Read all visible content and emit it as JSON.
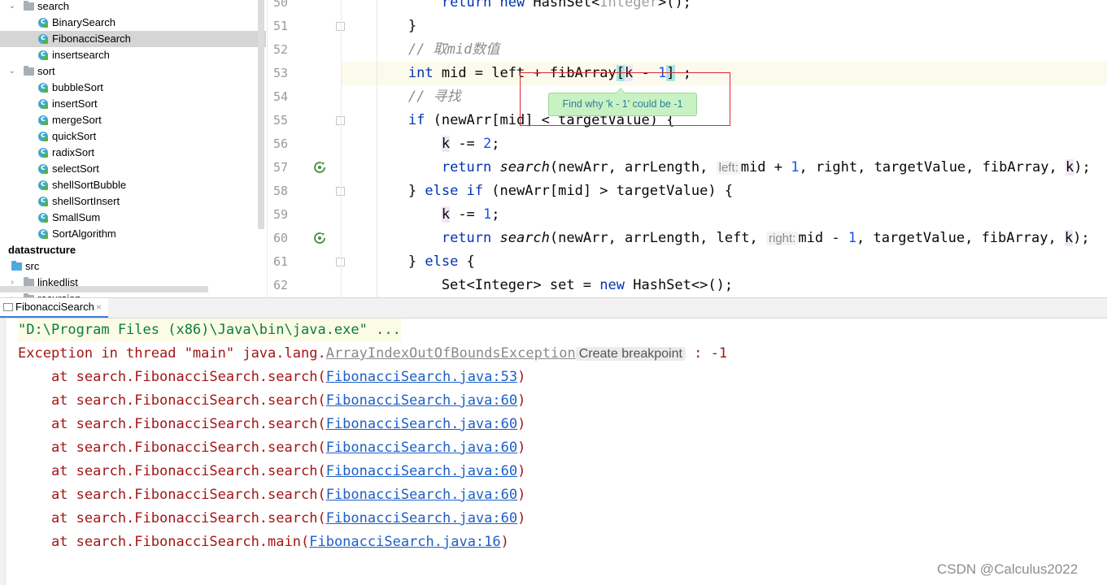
{
  "project_tree": {
    "nodes": [
      {
        "label": "search",
        "icon": "folder-icon",
        "indent": 1,
        "arrow": "down"
      },
      {
        "label": "BinarySearch",
        "icon": "class-icon",
        "indent": 3
      },
      {
        "label": "FibonacciSearch",
        "icon": "class-icon",
        "indent": 3,
        "selected": true
      },
      {
        "label": "insertsearch",
        "icon": "class-icon",
        "indent": 3
      },
      {
        "label": "sort",
        "icon": "folder-icon",
        "indent": 1,
        "arrow": "down"
      },
      {
        "label": "bubbleSort",
        "icon": "class-icon",
        "indent": 3
      },
      {
        "label": "insertSort",
        "icon": "class-icon",
        "indent": 3
      },
      {
        "label": "mergeSort",
        "icon": "class-icon",
        "indent": 3
      },
      {
        "label": "quickSort",
        "icon": "class-icon",
        "indent": 3
      },
      {
        "label": "radixSort",
        "icon": "class-icon",
        "indent": 3
      },
      {
        "label": "selectSort",
        "icon": "class-icon",
        "indent": 3
      },
      {
        "label": "shellSortBubble",
        "icon": "class-icon",
        "indent": 3
      },
      {
        "label": "shellSortInsert",
        "icon": "class-icon",
        "indent": 3
      },
      {
        "label": "SmallSum",
        "icon": "class-icon",
        "indent": 3
      },
      {
        "label": "SortAlgorithm",
        "icon": "class-icon",
        "indent": 3
      },
      {
        "label": "datastructure",
        "icon": "none",
        "indent": 0,
        "bold": true
      },
      {
        "label": "src",
        "icon": "folder-blue-icon",
        "indent": 0,
        "arrow": "none"
      },
      {
        "label": "linkedlist",
        "icon": "folder-icon",
        "indent": 1,
        "arrow": "right"
      },
      {
        "label": "recursion",
        "icon": "folder-icon",
        "indent": 1,
        "arrow": "right"
      }
    ]
  },
  "editor": {
    "lines": [
      {
        "num": "50",
        "segs": [
          [
            "",
            "            "
          ],
          [
            "kw",
            "return new "
          ],
          [
            "",
            "HashSet<"
          ],
          [
            "gen",
            "Integer"
          ],
          [
            "",
            ">();"
          ]
        ]
      },
      {
        "num": "51",
        "segs": [
          [
            "",
            "        }"
          ]
        ],
        "fold": true
      },
      {
        "num": "52",
        "segs": [
          [
            "",
            "        "
          ],
          [
            "cm",
            "// 取mid数值"
          ]
        ]
      },
      {
        "num": "53",
        "current": true,
        "segs": [
          [
            "",
            "        "
          ],
          [
            "kw",
            "int"
          ],
          [
            "",
            " mid = left + fibArray"
          ],
          [
            "bracket",
            "["
          ],
          [
            "kref",
            "k"
          ],
          [
            "",
            " - "
          ],
          [
            "num",
            "1"
          ],
          [
            "bracket",
            "]"
          ],
          [
            "",
            " ;"
          ]
        ]
      },
      {
        "num": "54",
        "segs": [
          [
            "",
            "        "
          ],
          [
            "cm",
            "// 寻找"
          ]
        ]
      },
      {
        "num": "55",
        "fold": true,
        "segs": [
          [
            "",
            "        "
          ],
          [
            "kw",
            "if"
          ],
          [
            "",
            " (newArr[mid] < targetValue) {"
          ]
        ]
      },
      {
        "num": "56",
        "segs": [
          [
            "",
            "            "
          ],
          [
            "kref",
            "k"
          ],
          [
            "",
            " -= "
          ],
          [
            "num",
            "2"
          ],
          [
            "",
            ";"
          ]
        ]
      },
      {
        "num": "57",
        "recursion": true,
        "segs": [
          [
            "",
            "            "
          ],
          [
            "kw",
            "return "
          ],
          [
            "itl",
            "search"
          ],
          [
            "",
            "(newArr, arrLength, "
          ],
          [
            "hint",
            "left:"
          ],
          [
            "",
            "mid + "
          ],
          [
            "num",
            "1"
          ],
          [
            "",
            ", right, targetValue, fibArray, "
          ],
          [
            "kref",
            "k"
          ],
          [
            "",
            ");"
          ]
        ]
      },
      {
        "num": "58",
        "fold": true,
        "segs": [
          [
            "",
            "        } "
          ],
          [
            "kw",
            "else if"
          ],
          [
            "",
            " (newArr[mid] > targetValue) {"
          ]
        ]
      },
      {
        "num": "59",
        "segs": [
          [
            "",
            "            "
          ],
          [
            "kref",
            "k"
          ],
          [
            "",
            " -= "
          ],
          [
            "num",
            "1"
          ],
          [
            "",
            ";"
          ]
        ]
      },
      {
        "num": "60",
        "recursion": true,
        "segs": [
          [
            "",
            "            "
          ],
          [
            "kw",
            "return "
          ],
          [
            "itl",
            "search"
          ],
          [
            "",
            "(newArr, arrLength, left, "
          ],
          [
            "hint",
            "right:"
          ],
          [
            "",
            "mid - "
          ],
          [
            "num",
            "1"
          ],
          [
            "",
            ", targetValue, fibArray, "
          ],
          [
            "kref",
            "k"
          ],
          [
            "",
            ");"
          ]
        ]
      },
      {
        "num": "61",
        "fold": true,
        "segs": [
          [
            "",
            "        } "
          ],
          [
            "kw",
            "else"
          ],
          [
            "",
            " {"
          ]
        ]
      },
      {
        "num": "62",
        "segs": [
          [
            "",
            "            Set<Integer> set = "
          ],
          [
            "kw",
            "new"
          ],
          [
            "",
            " HashSet<>();"
          ]
        ]
      }
    ],
    "tooltip": "Find why 'k - 1' could be -1"
  },
  "run_panel": {
    "tab_label": "FibonacciSearch",
    "tab_close": "×",
    "command": "\"D:\\Program Files (x86)\\Java\\bin\\java.exe\" ...",
    "exception": {
      "prefix": "Exception in thread \"main\" java.lang.",
      "name": "ArrayIndexOutOfBoundsException",
      "action": "Create breakpoint",
      "suffix": " : -1"
    },
    "trace": [
      {
        "at": "    at search.FibonacciSearch.search(",
        "link": "FibonacciSearch.java:53",
        "end": ")"
      },
      {
        "at": "    at search.FibonacciSearch.search(",
        "link": "FibonacciSearch.java:60",
        "end": ")"
      },
      {
        "at": "    at search.FibonacciSearch.search(",
        "link": "FibonacciSearch.java:60",
        "end": ")"
      },
      {
        "at": "    at search.FibonacciSearch.search(",
        "link": "FibonacciSearch.java:60",
        "end": ")"
      },
      {
        "at": "    at search.FibonacciSearch.search(",
        "link": "FibonacciSearch.java:60",
        "end": ")"
      },
      {
        "at": "    at search.FibonacciSearch.search(",
        "link": "FibonacciSearch.java:60",
        "end": ")"
      },
      {
        "at": "    at search.FibonacciSearch.search(",
        "link": "FibonacciSearch.java:60",
        "end": ")"
      },
      {
        "at": "    at search.FibonacciSearch.main(",
        "link": "FibonacciSearch.java:16",
        "end": ")"
      }
    ]
  },
  "watermark": "CSDN @Calculus2022",
  "colors": {
    "accent": "#3a7cdb",
    "error": "#a31515",
    "link": "#1d5fc7",
    "annotation_box": "#e0282e"
  }
}
